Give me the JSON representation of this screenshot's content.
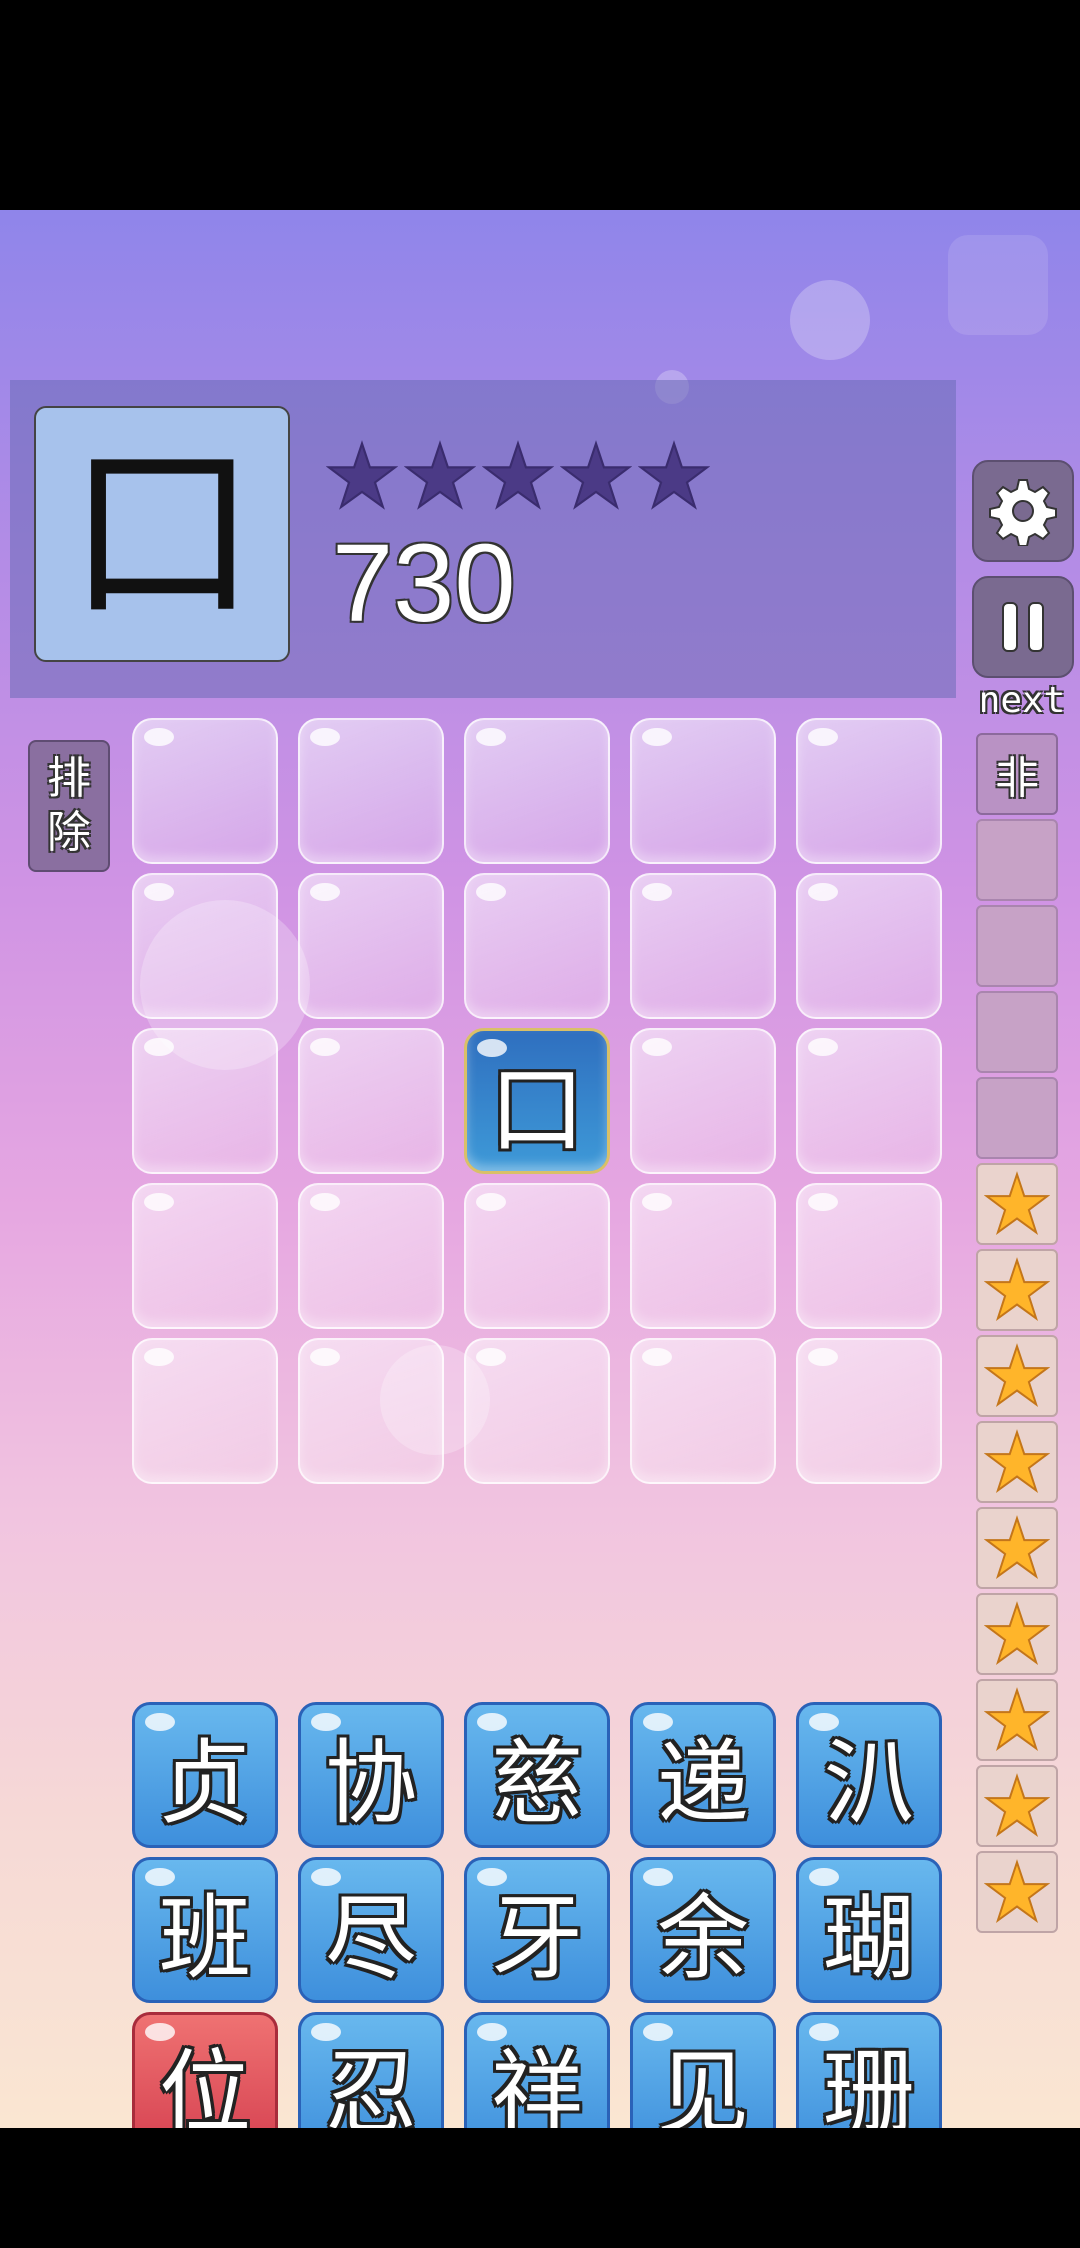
{
  "header": {
    "target_char": "口",
    "score": "730",
    "stars": [
      "filled",
      "filled",
      "filled",
      "filled",
      "filled"
    ]
  },
  "colors": {
    "star_dark": "#4b3a86",
    "star_gold": "#ffb52a",
    "tile_blue": "#3e8fdc",
    "tile_red": "#d54050"
  },
  "side": {
    "settings_icon": "gear-icon",
    "pause_icon": "pause-icon",
    "next_label": "next",
    "exclude_label_1": "排",
    "exclude_label_2": "除"
  },
  "queue": {
    "next_char": "非",
    "empty_slots": 4,
    "star_slots": 9
  },
  "board": {
    "rows": [
      [
        "",
        "",
        "",
        "",
        ""
      ],
      [
        "",
        "",
        "",
        "",
        ""
      ],
      [
        "",
        "",
        "口",
        "",
        ""
      ],
      [
        "",
        "",
        "",
        "",
        ""
      ],
      [
        "",
        "",
        "",
        "",
        ""
      ]
    ]
  },
  "tray": {
    "rows": [
      [
        {
          "char": "贞",
          "color": "blue"
        },
        {
          "char": "协",
          "color": "blue"
        },
        {
          "char": "慈",
          "color": "blue"
        },
        {
          "char": "递",
          "color": "blue"
        },
        {
          "char": "汃",
          "color": "blue"
        }
      ],
      [
        {
          "char": "班",
          "color": "blue"
        },
        {
          "char": "尽",
          "color": "blue"
        },
        {
          "char": "牙",
          "color": "blue"
        },
        {
          "char": "余",
          "color": "blue"
        },
        {
          "char": "瑚",
          "color": "blue"
        }
      ],
      [
        {
          "char": "位",
          "color": "red"
        },
        {
          "char": "忍",
          "color": "blue"
        },
        {
          "char": "祥",
          "color": "blue"
        },
        {
          "char": "见",
          "color": "blue"
        },
        {
          "char": "珊",
          "color": "blue"
        }
      ]
    ]
  }
}
